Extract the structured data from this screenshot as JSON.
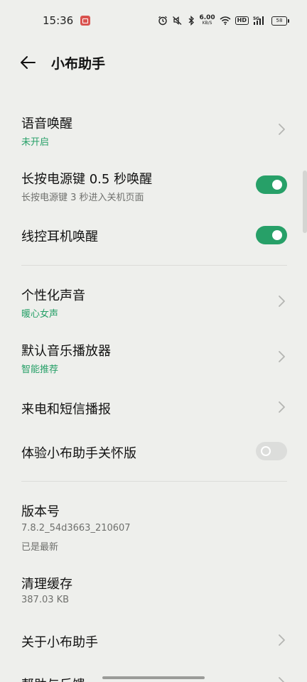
{
  "status_bar": {
    "time": "15:36",
    "net_speed_value": "6.00",
    "net_speed_unit": "KB/S",
    "hd_label": "HD",
    "signal_label": "5G",
    "battery_level": "58",
    "icons": [
      "alarm-icon",
      "mute-icon",
      "bluetooth-icon",
      "wifi-icon",
      "signal-icon",
      "battery-icon"
    ]
  },
  "header": {
    "title": "小布助手"
  },
  "settings": {
    "voice_wakeup": {
      "title": "语音唤醒",
      "status": "未开启"
    },
    "power_key_wakeup": {
      "title": "长按电源键 0.5 秒唤醒",
      "subtitle": "长按电源键 3 秒进入关机页面",
      "enabled": true
    },
    "wired_headset_wakeup": {
      "title": "线控耳机唤醒",
      "enabled": true
    },
    "personalized_voice": {
      "title": "个性化声音",
      "value": "暖心女声"
    },
    "default_music_player": {
      "title": "默认音乐播放器",
      "value": "智能推荐"
    },
    "call_sms_broadcast": {
      "title": "来电和短信播报"
    },
    "care_version": {
      "title": "体验小布助手关怀版",
      "enabled": false
    },
    "version": {
      "title": "版本号",
      "number": "7.8.2_54d3663_210607",
      "status": "已是最新"
    },
    "clear_cache": {
      "title": "清理缓存",
      "size": "387.03 KB"
    },
    "about": {
      "title": "关于小布助手"
    },
    "help_feedback": {
      "title": "帮助与反馈"
    }
  },
  "colors": {
    "accent": "#27a068",
    "background": "#eeefec",
    "toggle_off": "#dcdddb"
  }
}
